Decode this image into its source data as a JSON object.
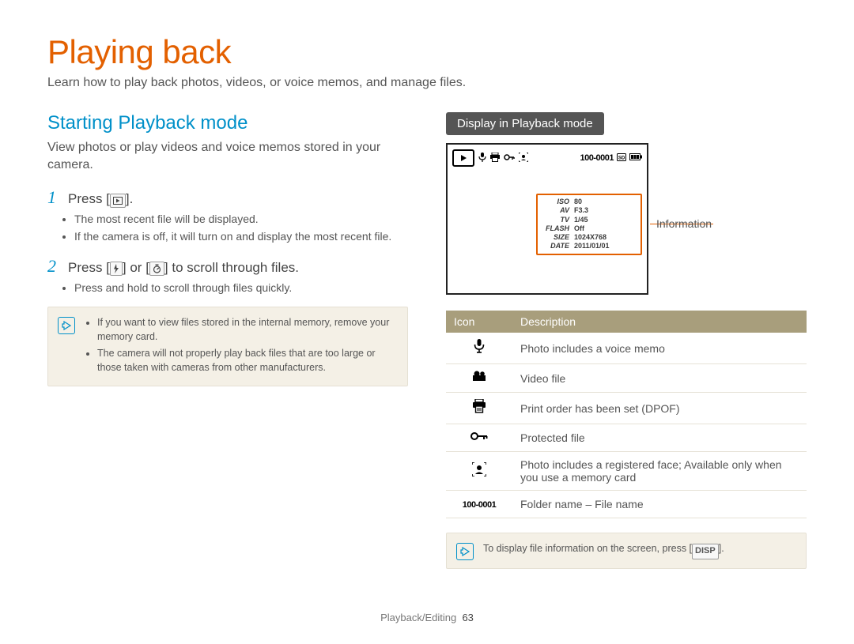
{
  "title": "Playing back",
  "intro": "Learn how to play back photos, videos, or voice memos, and manage files.",
  "left": {
    "section_heading": "Starting Playback mode",
    "section_desc": "View photos or play videos and voice memos stored in your camera.",
    "steps": [
      {
        "num": "1",
        "text_before": "Press [",
        "text_after": "].",
        "bullets": [
          "The most recent file will be displayed.",
          "If the camera is off, it will turn on and display the most recent file."
        ]
      },
      {
        "num": "2",
        "text_before": "Press [",
        "text_mid": "] or [",
        "text_after": "] to scroll through files.",
        "bullets": [
          "Press and hold to scroll through files quickly."
        ]
      }
    ],
    "note": [
      "If you want to view files stored in the internal memory, remove your memory card.",
      "The camera will not properly play back files that are too large or those taken with cameras from other manufacturers."
    ]
  },
  "right": {
    "pill": "Display in Playback mode",
    "callout": "Information",
    "screen_topbar_text": "100-0001",
    "info": [
      {
        "k": "ISO",
        "v": "80"
      },
      {
        "k": "AV",
        "v": "F3.3"
      },
      {
        "k": "TV",
        "v": "1/45"
      },
      {
        "k": "FLASH",
        "v": "Off"
      },
      {
        "k": "SIZE",
        "v": "1024X768"
      },
      {
        "k": "DATE",
        "v": "2011/01/01"
      }
    ],
    "table": {
      "head_icon": "Icon",
      "head_desc": "Description",
      "rows": [
        {
          "icon": "mic",
          "desc": "Photo includes a voice memo"
        },
        {
          "icon": "video",
          "desc": "Video file"
        },
        {
          "icon": "print",
          "desc": "Print order has been set (DPOF)"
        },
        {
          "icon": "lock",
          "desc": "Protected file"
        },
        {
          "icon": "face",
          "desc": "Photo includes a registered face; Available only when you use a memory card"
        },
        {
          "icon": "folder",
          "desc": "Folder name – File name"
        }
      ]
    },
    "note2_before": "To display file information on the screen, press [",
    "note2_after": "].",
    "disp_label": "DISP"
  },
  "footer": {
    "section": "Playback/Editing",
    "page": "63"
  }
}
